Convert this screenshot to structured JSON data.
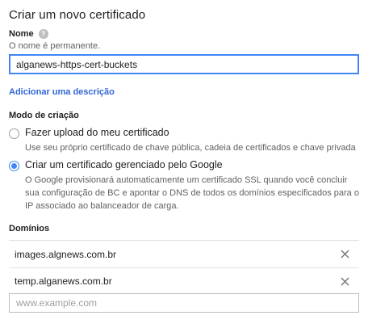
{
  "dialog": {
    "title": "Criar um novo certificado"
  },
  "name_field": {
    "label": "Nome",
    "help_icon_glyph": "?",
    "hint": "O nome é permanente.",
    "value": "alganews-https-cert-buckets"
  },
  "add_description_link": "Adicionar uma descrição",
  "creation_mode": {
    "label": "Modo de criação",
    "options": [
      {
        "label": "Fazer upload do meu certificado",
        "description": "Use seu próprio certificado de chave pública, cadeia de certificados e chave privada",
        "selected": false
      },
      {
        "label": "Criar um certificado gerenciado pelo Google",
        "description": "O Google provisionará automaticamente um certificado SSL quando você concluir sua configuração de BC e apontar o DNS de todos os domínios especificados para o IP associado ao balanceador de carga.",
        "selected": true
      }
    ]
  },
  "domains": {
    "label": "Domínios",
    "items": [
      "images.algnews.com.br",
      "temp.alganews.com.br"
    ],
    "input_placeholder": "www.example.com",
    "input_value": ""
  },
  "colors": {
    "accent": "#4285f4",
    "link": "#3367d6",
    "text": "#212121",
    "secondary_text": "#616161",
    "border": "#e0e0e0"
  },
  "icons": {
    "help": "help-circle-icon",
    "remove": "close-icon"
  }
}
